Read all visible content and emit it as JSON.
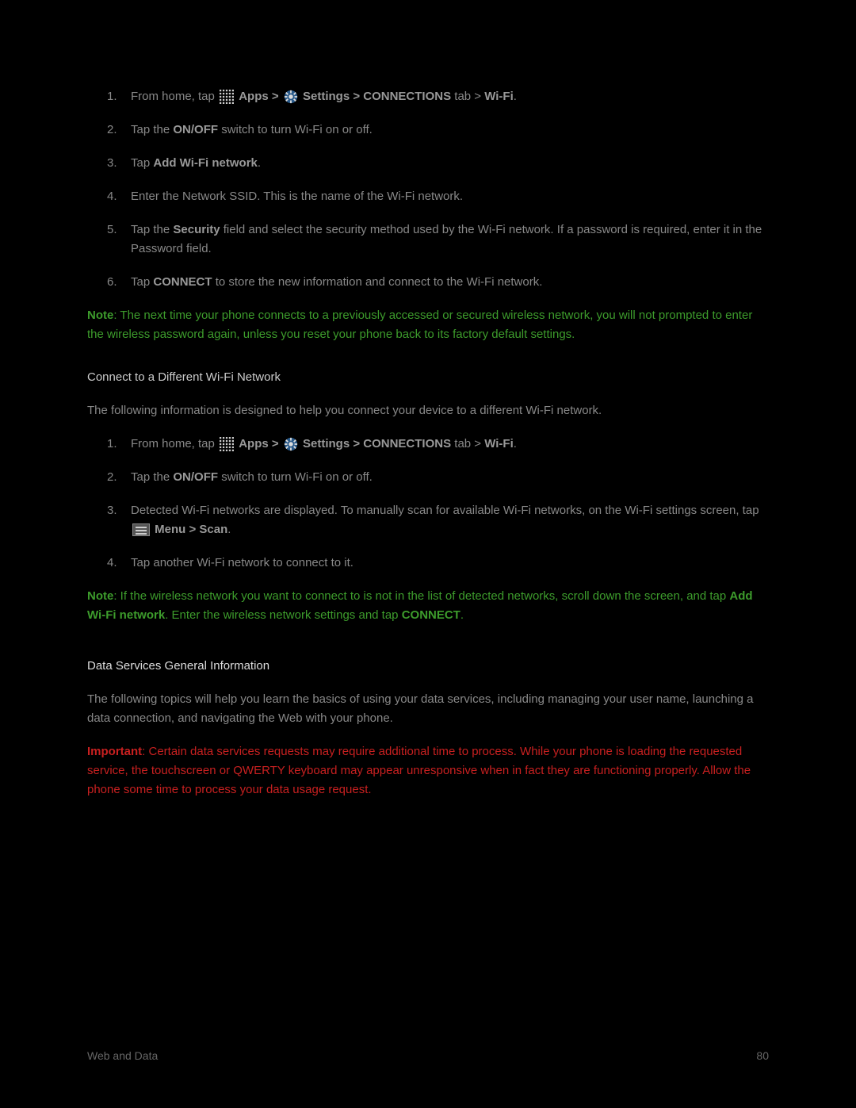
{
  "section1": {
    "steps": [
      {
        "prefix": "From home, tap ",
        "bold1": "Apps > ",
        "bold2": "Settings > CONNECTIONS",
        "suffix1": " tab > ",
        "bold3": "Wi-Fi",
        "end": "."
      },
      {
        "prefix": "Tap the ",
        "bold1": "ON/OFF",
        "suffix": " switch to turn Wi-Fi on or off."
      },
      {
        "prefix": "Tap ",
        "bold1": "Add Wi-Fi network",
        "suffix": "."
      },
      {
        "text": "Enter the Network SSID. This is the name of the Wi-Fi network."
      },
      {
        "prefix": "Tap the ",
        "bold1": "Security",
        "suffix": " field and select the security method used by the Wi-Fi network. If a password is required, enter it in the Password field."
      },
      {
        "prefix": "Tap ",
        "bold1": "CONNECT",
        "suffix": " to store the new information and connect to the Wi-Fi network."
      }
    ],
    "note": {
      "label": "Note",
      "text": ": The next time your phone connects to a previously accessed or secured wireless network, you will not prompted to enter the wireless password again, unless you reset your phone back to its factory default settings."
    }
  },
  "section2": {
    "heading": "Connect to a Different Wi-Fi Network",
    "intro": "The following information is designed to help you connect your device to a different Wi-Fi network.",
    "steps": [
      {
        "prefix": "From home, tap ",
        "bold1": "Apps > ",
        "bold2": "Settings > CONNECTIONS",
        "suffix1": " tab > ",
        "bold3": "Wi-Fi",
        "end": "."
      },
      {
        "prefix": "Tap the ",
        "bold1": "ON/OFF",
        "suffix": " switch to turn Wi-Fi on or off."
      },
      {
        "prefix": "Detected Wi-Fi networks are displayed. To manually scan for available Wi-Fi networks, on the Wi-Fi settings screen, tap ",
        "bold1": "Menu > Scan",
        "suffix": "."
      },
      {
        "text": "Tap another Wi-Fi network to connect to it."
      }
    ],
    "note": {
      "label": "Note",
      "text1": ": If the wireless network you want to connect to is not in the list of detected networks, scroll down the screen, and tap ",
      "bold1": "Add Wi-Fi network",
      "text2": ". Enter the wireless network settings and tap ",
      "bold2": "CONNECT",
      "text3": "."
    }
  },
  "section3": {
    "heading": "Data Services General Information",
    "intro": "The following topics will help you learn the basics of using your data services, including managing your user name, launching a data connection, and navigating the Web with your phone.",
    "important": {
      "label": "Important",
      "text": ": Certain data services requests may require additional time to process. While your phone is loading the requested service, the touchscreen or QWERTY keyboard may appear unresponsive when in fact they are functioning properly. Allow the phone some time to process your data usage request."
    }
  },
  "footer": {
    "left": "Web and Data",
    "right": "80"
  }
}
